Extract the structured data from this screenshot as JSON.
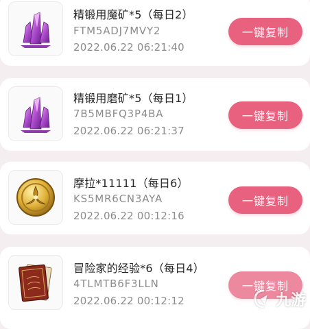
{
  "items": [
    {
      "title": "精锻用魔矿*5（每日2）",
      "code": "FTM5ADJ7MVY2",
      "date": "2022.06.22 06:21:40",
      "button": "一键复制",
      "icon": "purple-crystal-icon"
    },
    {
      "title": "精锻用磨矿*5（每日1）",
      "code": "7B5MBFQ3P4BA",
      "date": "2022.06.22 06:21:37",
      "button": "一键复制",
      "icon": "purple-crystal-icon"
    },
    {
      "title": "摩拉*11111（每日6）",
      "code": "KS5MR6CN3AYA",
      "date": "2022.06.22 00:12:16",
      "button": "一键复制",
      "icon": "mora-coin-icon"
    },
    {
      "title": "冒险家的经验*6（每日4）",
      "code": "4TLMTB6F3LLN",
      "date": "2022.06.22 00:12:12",
      "button": "一键复制",
      "icon": "adventurer-book-icon"
    }
  ],
  "watermark": {
    "text": "九游",
    "icon": "jiuyou-logo-icon"
  },
  "colors": {
    "button": "#e8627f",
    "background": "#f4eef0",
    "card": "#ffffff"
  }
}
